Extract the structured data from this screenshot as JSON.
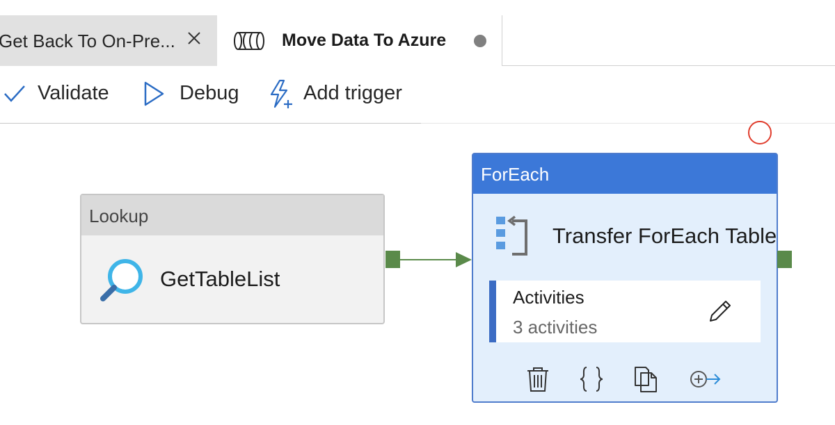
{
  "tabs": [
    {
      "label": "Get Back To On-Pre...",
      "active": false
    },
    {
      "label": "Move Data To Azure",
      "active": true,
      "unsaved": true
    }
  ],
  "toolbar": {
    "validate_label": "Validate",
    "debug_label": "Debug",
    "add_trigger_label": "Add trigger"
  },
  "lookup": {
    "type": "Lookup",
    "name": "GetTableList",
    "icon": "search-icon"
  },
  "foreach": {
    "type": "ForEach",
    "name": "Transfer ForEach Table",
    "icon": "foreach-icon",
    "activities_title": "Activities",
    "activities_count": "3 activities",
    "actions": [
      "delete-icon",
      "code-icon",
      "copy-icon",
      "add-output-icon"
    ]
  },
  "colors": {
    "foreach_header": "#3c78d8",
    "foreach_body": "#e3effc",
    "connector": "#5a8a4a",
    "accent": "#3c78d8",
    "status_circle": "#e03c2c"
  }
}
